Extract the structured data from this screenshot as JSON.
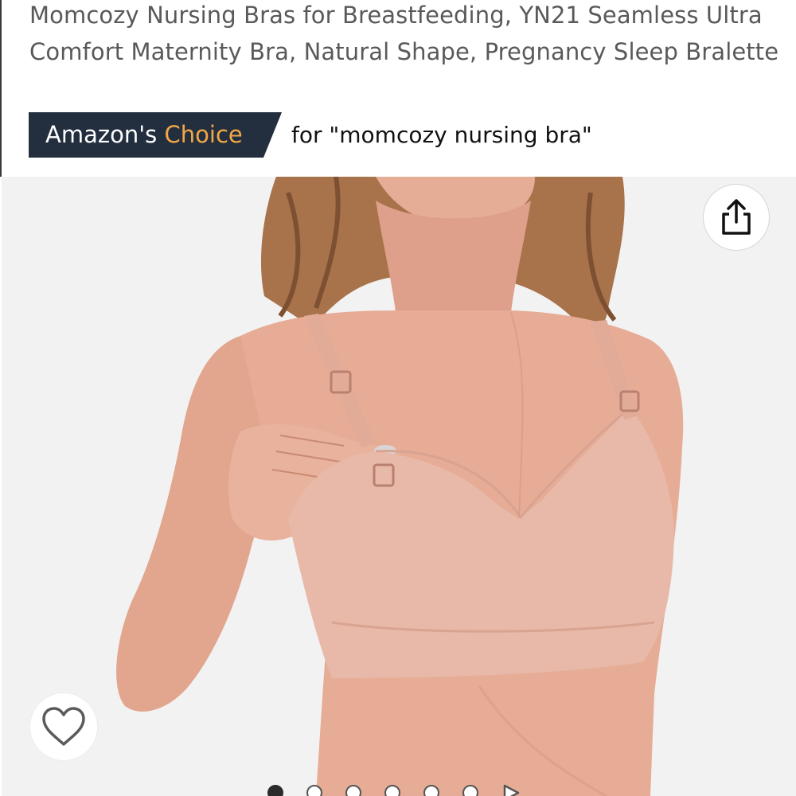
{
  "product": {
    "title": "Momcozy Nursing Bras for Breastfeeding, YN21 Seamless Ultra Comfort Maternity Bra, Natural Shape, Pregnancy Sleep Bralette"
  },
  "badge": {
    "prefix": "Amazon's",
    "highlight": "Choice",
    "query": "for \"momcozy nursing bra\"",
    "bg_color": "#232f3e",
    "highlight_color": "#f3a847"
  },
  "image": {
    "alt": "Momcozy nursing bra product photo"
  },
  "actions": {
    "share_icon": "share-icon",
    "wishlist_icon": "heart-icon"
  },
  "carousel": {
    "image_dots": 6,
    "active_index": 0,
    "video_icon": "play-icon"
  }
}
